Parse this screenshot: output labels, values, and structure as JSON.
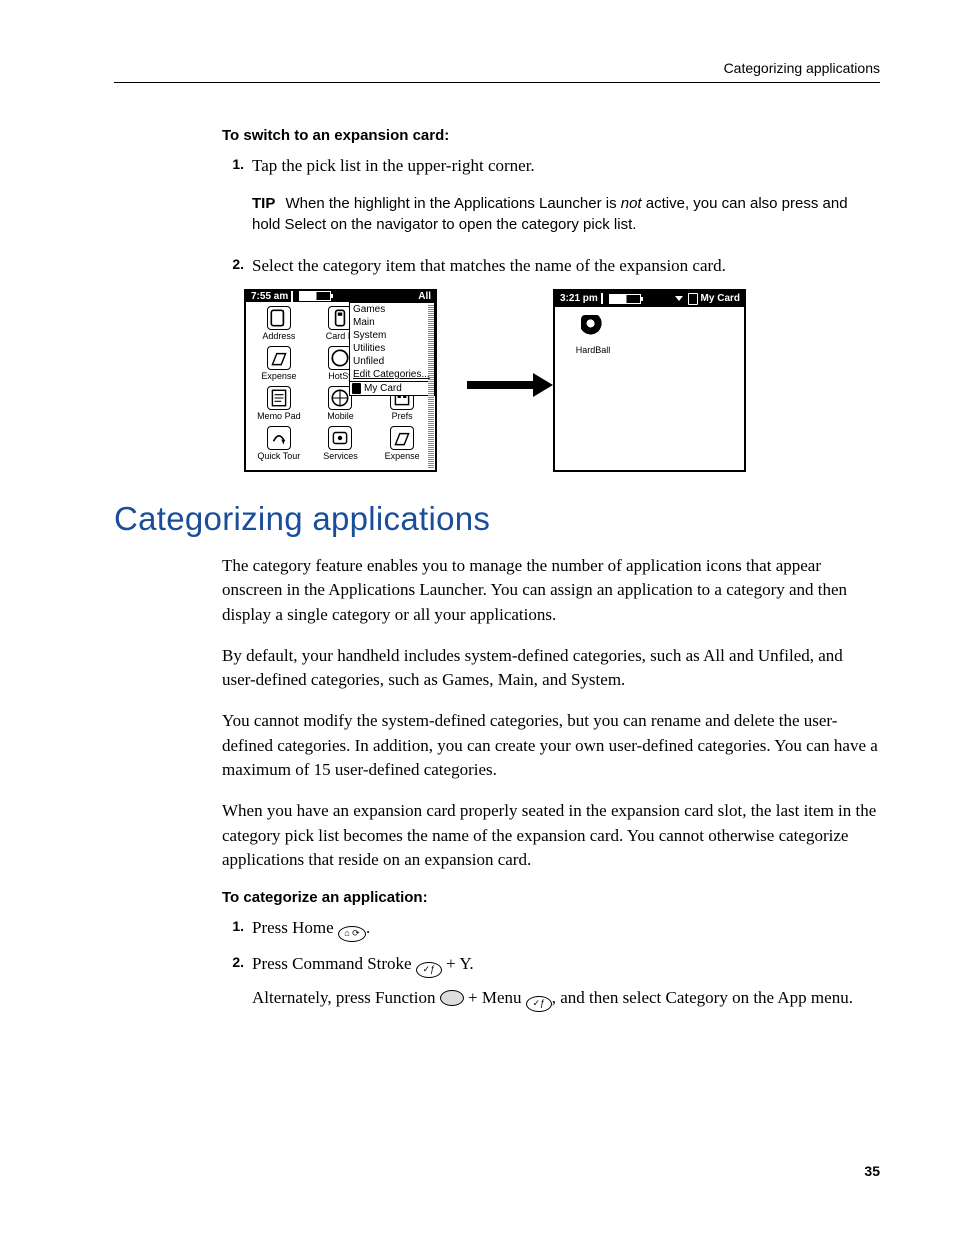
{
  "header": {
    "breadcrumb": "Categorizing applications"
  },
  "sec1": {
    "subheading": "To switch to an expansion card:",
    "step1": {
      "num": "1.",
      "text": "Tap the pick list in the upper-right corner."
    },
    "tip": {
      "label": "TIP",
      "before": "When the highlight in the Applications Launcher is ",
      "italic": "not",
      "after": " active, you can also press and hold Select on the navigator to open the category pick list."
    },
    "step2": {
      "num": "2.",
      "text": "Select the category item that matches the name of the expansion card."
    }
  },
  "fig": {
    "left": {
      "time": "7:55 am",
      "cat_label": "All",
      "menu": {
        "items": [
          "Games",
          "Main",
          "System",
          "Utilities",
          "Unfiled"
        ],
        "edit": "Edit Categories...",
        "card": "My Card"
      },
      "apps": {
        "r1c1": "Address",
        "r1c2": "Card In",
        "r1c3": "",
        "r2c1": "Expense",
        "r2c2": "HotSy",
        "r2c3": "",
        "r3c1": "Memo Pad",
        "r3c2": "Mobile",
        "r3c3": "Prefs",
        "r4c1": "Quick Tour",
        "r4c2": "Services",
        "r4c3": "Expense"
      }
    },
    "right": {
      "time": "3:21 pm",
      "cat_label": "My Card",
      "app1": "HardBall"
    }
  },
  "h1": "Categorizing applications",
  "body": {
    "p1": "The category feature enables you to manage the number of application icons that appear onscreen in the Applications Launcher. You can assign an application to a category and then display a single category or all your applications.",
    "p2": "By default, your handheld includes system-defined categories, such as All and Unfiled, and user-defined categories, such as Games, Main, and System.",
    "p3": "You cannot modify the system-defined categories, but you can rename and delete the user-defined categories. In addition, you can create your own user-defined categories. You can have a maximum of 15 user-defined categories.",
    "p4": "When you have an expansion card properly seated in the expansion card slot, the last item in the category pick list becomes the name of the expansion card. You cannot otherwise categorize applications that reside on an expansion card."
  },
  "sec2": {
    "subheading": "To categorize an application:",
    "step1": {
      "num": "1.",
      "before": "Press Home ",
      "after": "."
    },
    "step2": {
      "num": "2.",
      "before": "Press Command Stroke ",
      "after": " + Y."
    },
    "alt": {
      "p1a": "Alternately, press Function ",
      "p1b": " + Menu ",
      "p1c": ", and then select Category on the App menu."
    }
  },
  "glyphs": {
    "home": "⌂ ⟳",
    "cmd": "✓ƒ",
    "menu": "✓ƒ",
    "func": " "
  },
  "page_num": "35"
}
